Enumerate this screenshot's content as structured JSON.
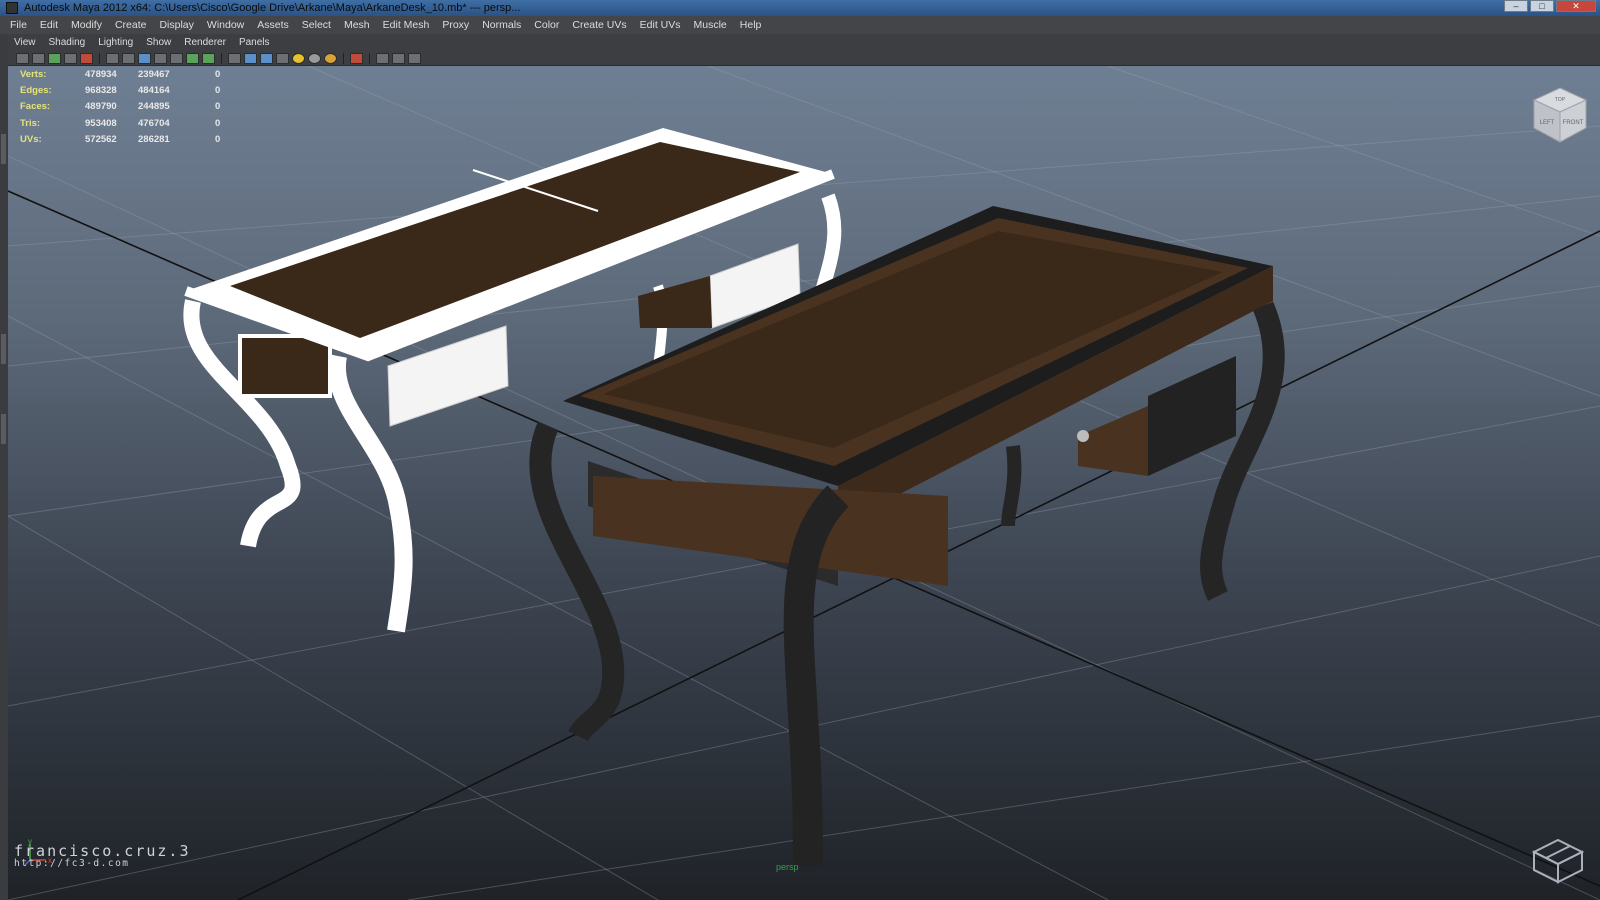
{
  "window": {
    "title": "Autodesk Maya 2012 x64: C:\\Users\\Cisco\\Google Drive\\Arkane\\Maya\\ArkaneDesk_10.mb*   ---   persp..."
  },
  "main_menu": [
    "File",
    "Edit",
    "Modify",
    "Create",
    "Display",
    "Window",
    "Assets",
    "Select",
    "Mesh",
    "Edit Mesh",
    "Proxy",
    "Normals",
    "Color",
    "Create UVs",
    "Edit UVs",
    "Muscle",
    "Help"
  ],
  "panel_menu": [
    "View",
    "Shading",
    "Lighting",
    "Show",
    "Renderer",
    "Panels"
  ],
  "toolbar_icons": [
    "select-camera-icon",
    "lock-camera-icon",
    "bookmark-icon",
    "image-plane-icon",
    "2d-pan-icon",
    "film-gate-icon",
    "grid-icon",
    "resolution-gate-icon",
    "gate-mask-icon",
    "field-chart-icon",
    "safe-action-icon",
    "safe-title-icon",
    "wireframe-icon",
    "smooth-shade-icon",
    "wireframe-on-shaded-icon",
    "textured-icon",
    "use-default-light-icon",
    "shadows-icon",
    "ambient-occlusion-icon",
    "isolate-select-icon",
    "xray-icon",
    "xray-joints-icon",
    "xray-components-icon"
  ],
  "stats": {
    "rows": [
      {
        "label": "Verts:",
        "v1": "478934",
        "v2": "239467",
        "v3": "0"
      },
      {
        "label": "Edges:",
        "v1": "968328",
        "v2": "484164",
        "v3": "0"
      },
      {
        "label": "Faces:",
        "v1": "489790",
        "v2": "244895",
        "v3": "0"
      },
      {
        "label": "Tris:",
        "v1": "953408",
        "v2": "476704",
        "v3": "0"
      },
      {
        "label": "UVs:",
        "v1": "572562",
        "v2": "286281",
        "v3": "0"
      }
    ]
  },
  "viewcube": {
    "left": "LEFT",
    "front": "FRONT",
    "top": "TOP"
  },
  "camera_label": "persp",
  "watermark": {
    "name": "francisco.cruz.3",
    "url": "http://fc3-d.com"
  },
  "axis": {
    "y": "y",
    "x": "x"
  },
  "colors": {
    "label": "#e5e37a",
    "wood": "#3a2819",
    "metal": "#2b2b2b",
    "camera": "#2fa24c"
  }
}
